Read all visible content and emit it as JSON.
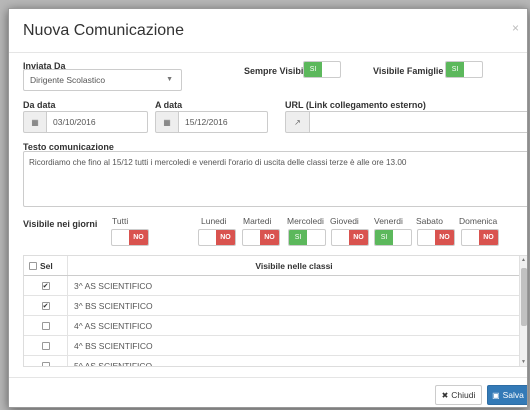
{
  "modal": {
    "title": "Nuova Comunicazione",
    "close": "×"
  },
  "inviata_da": {
    "label": "Inviata Da",
    "value": "Dirigente Scolastico"
  },
  "sempre_visibile": {
    "label": "Sempre Visibile",
    "state": "SI"
  },
  "visibile_famiglie": {
    "label": "Visibile Famiglie",
    "state": "SI"
  },
  "da_data": {
    "label": "Da data",
    "value": "03/10/2016"
  },
  "a_data": {
    "label": "A data",
    "value": "15/12/2016"
  },
  "url": {
    "label": "URL (Link collegamento esterno)",
    "value": ""
  },
  "testo": {
    "label": "Testo comunicazione",
    "value": "Ricordiamo che fino al 15/12 tutti i mercoledi e venerdi l'orario di uscita delle classi terze è alle ore 13.00"
  },
  "giorni": {
    "label": "Visibile nei giorni",
    "days": [
      {
        "name": "Tutti",
        "state": "NO"
      },
      {
        "name": "Lunedi",
        "state": "NO"
      },
      {
        "name": "Martedi",
        "state": "NO"
      },
      {
        "name": "Mercoledi",
        "state": "SI"
      },
      {
        "name": "Giovedi",
        "state": "NO"
      },
      {
        "name": "Venerdi",
        "state": "SI"
      },
      {
        "name": "Sabato",
        "state": "NO"
      },
      {
        "name": "Domenica",
        "state": "NO"
      }
    ]
  },
  "table": {
    "col_sel": "Sel",
    "col_classi": "Visibile nelle classi",
    "rows": [
      {
        "checked": true,
        "classe": "3^ AS SCIENTIFICO"
      },
      {
        "checked": true,
        "classe": "3^ BS SCIENTIFICO"
      },
      {
        "checked": false,
        "classe": "4^ AS SCIENTIFICO"
      },
      {
        "checked": false,
        "classe": "4^ BS SCIENTIFICO"
      },
      {
        "checked": false,
        "classe": "5^ AS SCIENTIFICO"
      }
    ]
  },
  "buttons": {
    "chiudi": "Chiudi",
    "salva": "Salva"
  },
  "colors": {
    "on": "#5cb85c",
    "off": "#d9534f",
    "primary": "#337ab7"
  }
}
